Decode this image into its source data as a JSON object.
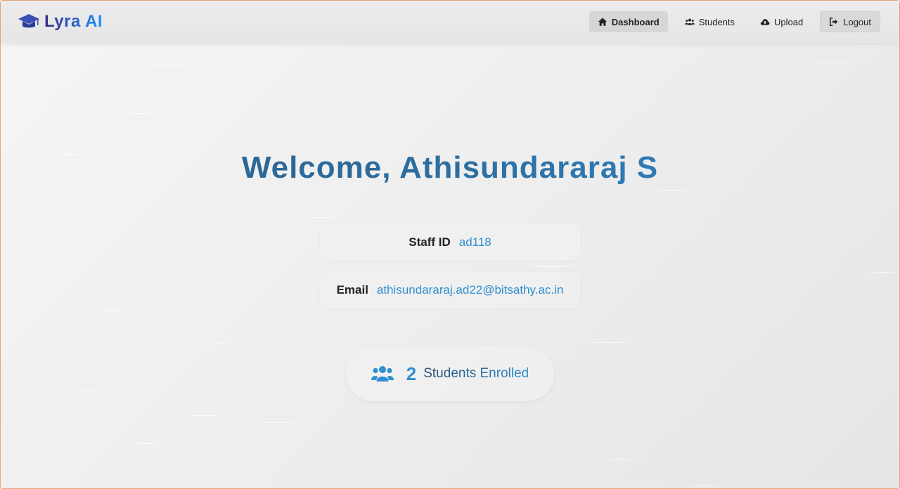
{
  "brand": {
    "name": "Lyra AI",
    "icon": "graduation-cap-icon",
    "colors": {
      "from": "#3b2a8a",
      "to": "#1e90ff"
    }
  },
  "nav": {
    "items": [
      {
        "label": "Dashboard",
        "icon": "home-icon",
        "active": true
      },
      {
        "label": "Students",
        "icon": "users-icon",
        "active": false
      },
      {
        "label": "Upload",
        "icon": "cloud-upload-icon",
        "active": false
      },
      {
        "label": "Logout",
        "icon": "sign-out-icon",
        "active": false
      }
    ]
  },
  "welcome": {
    "text": "Welcome, Athisundararaj S"
  },
  "profile": {
    "staff_id_label": "Staff ID",
    "staff_id_value": "ad118",
    "email_label": "Email",
    "email_value": "athisundararaj.ad22@bitsathy.ac.in"
  },
  "enrolled": {
    "icon": "users-icon",
    "count": "2",
    "label": "Students Enrolled"
  },
  "colors": {
    "accent": "#2f8fd0",
    "heading_dark": "#2d5e8a",
    "border": "#e8a87c"
  }
}
